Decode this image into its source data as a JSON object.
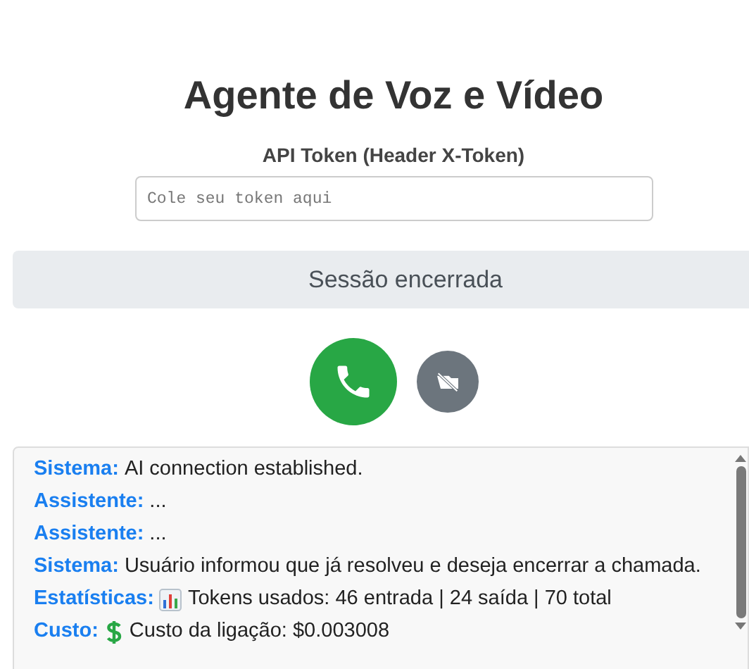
{
  "title": "Agente de Voz e Vídeo",
  "token": {
    "label": "API Token (Header X-Token)",
    "placeholder": "Cole seu token aqui"
  },
  "status": "Sessão encerrada",
  "controls": [
    {
      "kind": "call"
    },
    {
      "kind": "video-off"
    }
  ],
  "log": [
    {
      "kind": "text",
      "speaker": "Sistema:",
      "text": "AI connection established."
    },
    {
      "kind": "text",
      "speaker": "Assistente:",
      "text": "..."
    },
    {
      "kind": "text",
      "speaker": "Assistente:",
      "text": "..."
    },
    {
      "kind": "text",
      "speaker": "Sistema:",
      "text": "Usuário informou que já resolveu e deseja encerrar a chamada."
    },
    {
      "kind": "stats",
      "speaker": "Estatísticas:",
      "text": "Tokens usados: 46 entrada | 24 saída | 70 total"
    },
    {
      "kind": "cost",
      "speaker": "Custo:",
      "text": "Custo da ligação: $0.003008"
    }
  ]
}
